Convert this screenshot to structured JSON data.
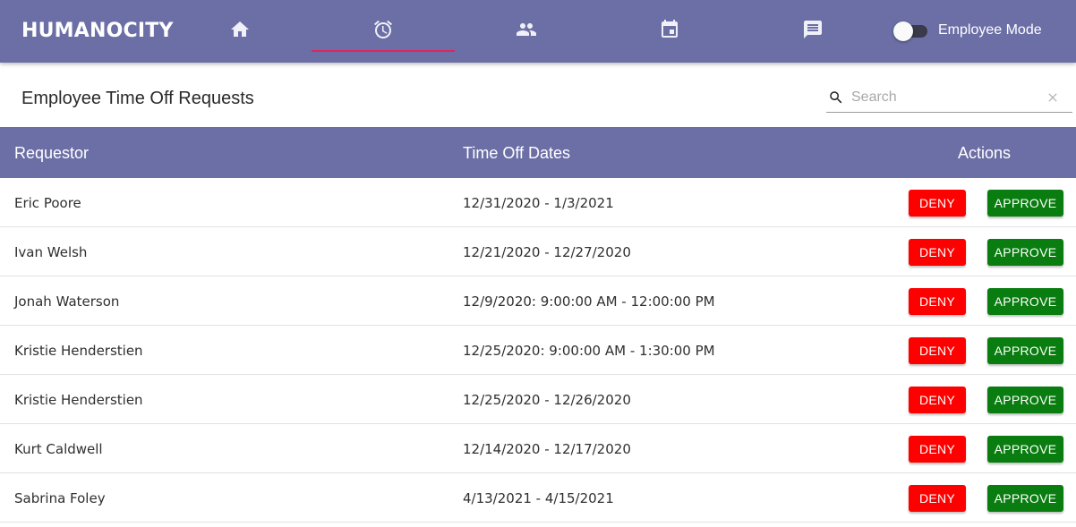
{
  "header": {
    "brand": "HUMANOCITY",
    "nav": [
      {
        "name": "nav-home",
        "icon": "home-icon",
        "active": false
      },
      {
        "name": "nav-time-off",
        "icon": "alarm-clock-icon",
        "active": true
      },
      {
        "name": "nav-people",
        "icon": "people-icon",
        "active": false
      },
      {
        "name": "nav-calendar",
        "icon": "calendar-icon",
        "active": false
      },
      {
        "name": "nav-messages",
        "icon": "message-icon",
        "active": false
      }
    ],
    "toggle_label": "Employee Mode",
    "toggle_on": false
  },
  "page": {
    "title": "Employee Time Off Requests"
  },
  "search": {
    "placeholder": "Search",
    "value": ""
  },
  "table": {
    "columns": {
      "requestor": "Requestor",
      "dates": "Time Off Dates",
      "actions": "Actions"
    },
    "deny_label": "DENY",
    "approve_label": "APPROVE",
    "rows": [
      {
        "name": "Eric Poore",
        "dates": "12/31/2020 - 1/3/2021"
      },
      {
        "name": "Ivan Welsh",
        "dates": "12/21/2020 - 12/27/2020"
      },
      {
        "name": "Jonah Waterson",
        "dates": "12/9/2020: 9:00:00 AM - 12:00:00 PM"
      },
      {
        "name": "Kristie Henderstien",
        "dates": "12/25/2020: 9:00:00 AM - 1:30:00 PM"
      },
      {
        "name": "Kristie Henderstien",
        "dates": "12/25/2020 - 12/26/2020"
      },
      {
        "name": "Kurt Caldwell",
        "dates": "12/14/2020 - 12/17/2020"
      },
      {
        "name": "Sabrina Foley",
        "dates": "4/13/2021 - 4/15/2021"
      }
    ]
  },
  "colors": {
    "primary": "#6c6fa6",
    "active_tab_underline": "#e0245e",
    "deny": "#ff0000",
    "approve": "#0a7d10"
  }
}
